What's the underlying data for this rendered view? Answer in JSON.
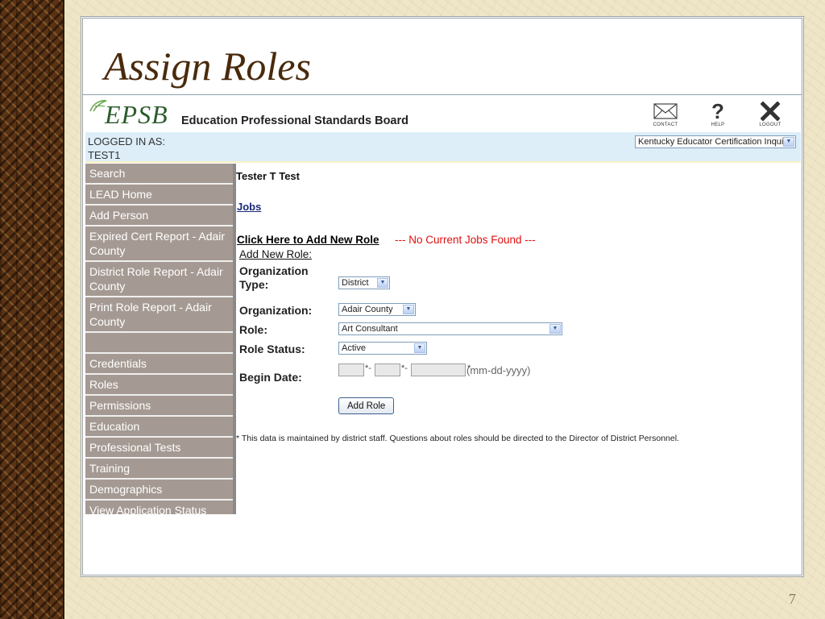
{
  "slide": {
    "title": "Assign Roles",
    "page_number": "7"
  },
  "header": {
    "logo_text": "EPSB",
    "org_name": "Education Professional Standards Board",
    "icons": [
      {
        "label": "CONTACT",
        "icon": "envelope-icon"
      },
      {
        "label": "HELP",
        "icon": "question-icon"
      },
      {
        "label": "LOGOUT",
        "icon": "x-icon"
      }
    ]
  },
  "login": {
    "label": "LOGGED IN AS:",
    "user": "TEST1",
    "app_select": "Kentucky Educator Certification Inquiry"
  },
  "nav": {
    "items": [
      "Search",
      "LEAD Home",
      "Add Person",
      "Expired Cert Report - Adair County",
      "District Role Report - Adair County",
      "Print Role Report - Adair County",
      "Credentials",
      "Roles",
      "Permissions",
      "Education",
      "Professional Tests",
      "Training",
      "Demographics",
      "View Application Status"
    ]
  },
  "content": {
    "person_name": "Tester T Test",
    "jobs_link": "Jobs",
    "add_role_link": "Click Here to Add New Role",
    "no_jobs": "--- No Current Jobs Found ---",
    "form_legend": "Add New Role:",
    "form": {
      "org_type_label": "Organization Type:",
      "org_type_value": "District",
      "org_label": "Organization:",
      "org_value": "Adair County",
      "role_label": "Role:",
      "role_value": "Art Consultant",
      "status_label": "Role Status:",
      "status_value": "Active",
      "begin_date_label": "Begin Date:",
      "date_sep": "*-",
      "date_required": "*",
      "date_format": "(mm-dd-yyyy)",
      "submit_label": "Add Role"
    },
    "disclaimer": "* This data is maintained by district staff. Questions about roles should be directed to the Director of District Personnel."
  },
  "colors": {
    "nav_bg": "#a59a93",
    "login_bar": "#ddeef9",
    "title": "#4a2a0c",
    "error_text": "#e01010",
    "logo_green": "#2b5c2b"
  }
}
